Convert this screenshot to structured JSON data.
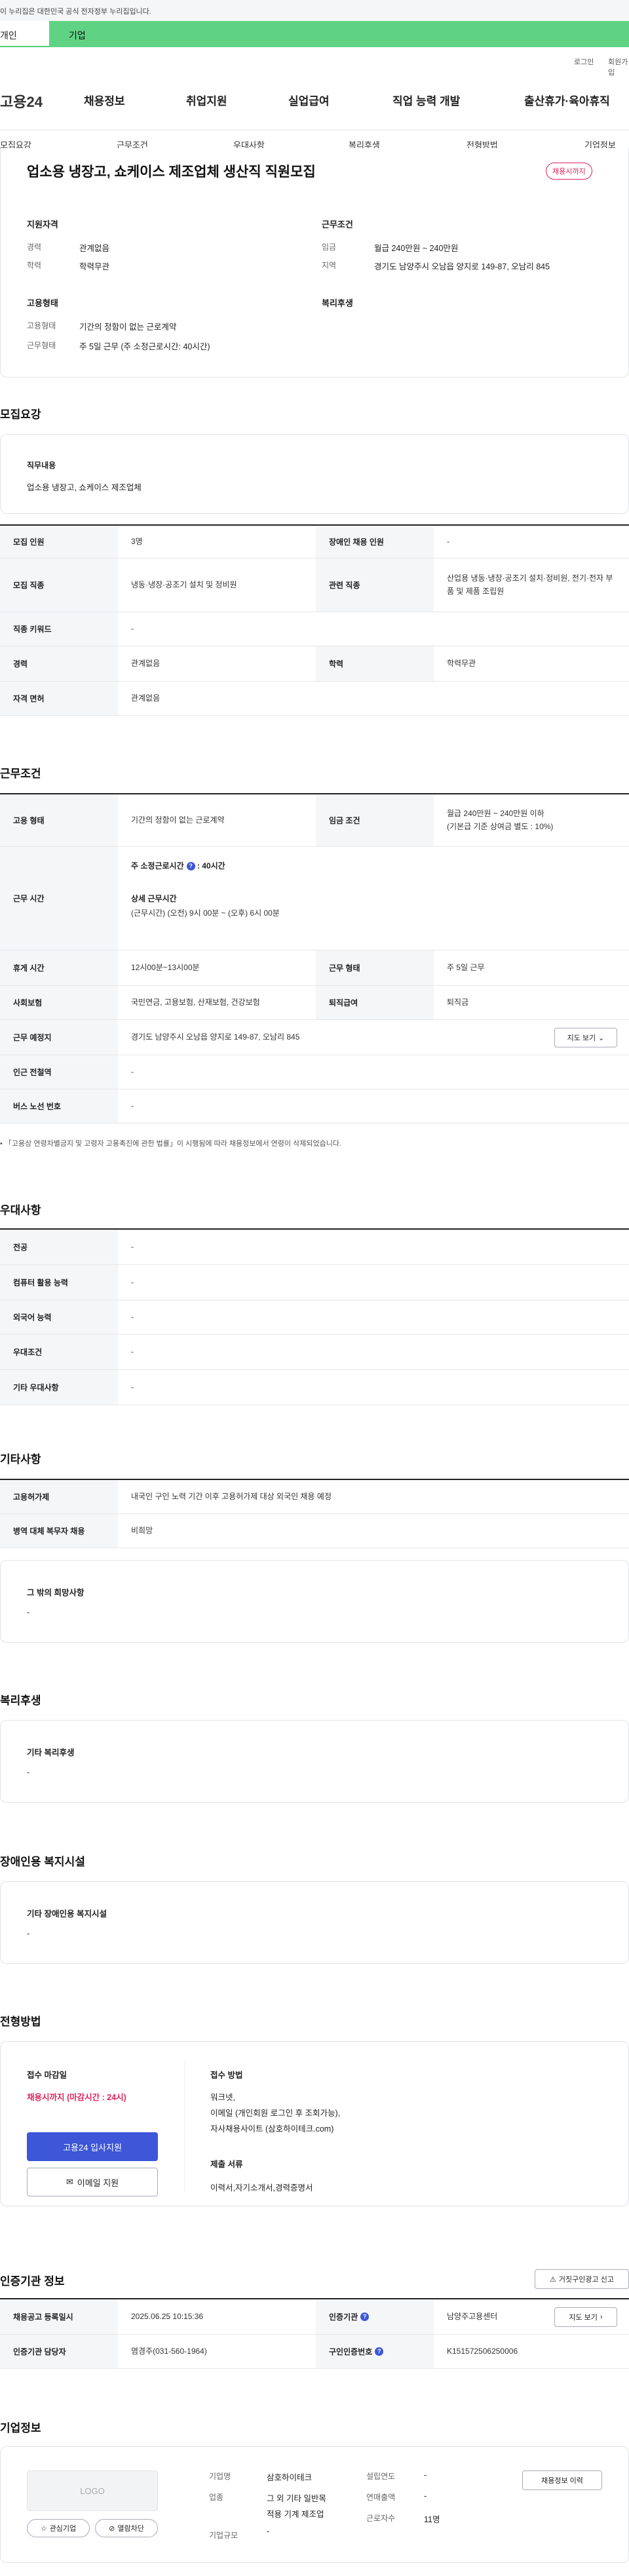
{
  "gov_banner": "이 누리집은 대한민국 공식 전자정부 누리집입니다.",
  "tabs": {
    "person": "개인",
    "company": "기업"
  },
  "util": {
    "login": "로그인",
    "join": "회원가입"
  },
  "logo": "고용24",
  "gnb": [
    "채용정보",
    "취업지원",
    "실업급여",
    "직업 능력 개발",
    "출산휴가·육아휴직"
  ],
  "subnav": [
    "모집요강",
    "근무조건",
    "우대사항",
    "복리후생",
    "전형방법",
    "기업정보"
  ],
  "summary": {
    "title": "업소용 냉장고, 쇼케이스 제조업체 생산직 직원모집",
    "badge": "채용시까지",
    "qual_h": "지원자격",
    "career_l": "경력",
    "career_v": "관계없음",
    "edu_l": "학력",
    "edu_v": "학력무관",
    "cond_h": "근무조건",
    "wage_l": "임금",
    "wage_v": "월급 240만원 ~ 240만원",
    "area_l": "지역",
    "area_v": "경기도 남양주시 오남읍 양지로 149-87, 오남리 845",
    "emp_h": "고용형태",
    "emp_l1": "고용형태",
    "emp_v1": "기간의 정함이 없는 근로계약",
    "emp_l2": "근무형태",
    "emp_v2": "주 5일 근무 (주 소정근로시간: 40시간)",
    "welfare_h": "복리후생"
  },
  "recruit": {
    "heading": "모집요강",
    "job_h": "직무내용",
    "job_v": "업소용 냉장고, 쇼케이스 제조업체",
    "rows": {
      "count_l": "모집 인원",
      "count_v": "3명",
      "dis_l": "장애인 채용 인원",
      "dis_v": "-",
      "type_l": "모집 직종",
      "type_v": "냉동·냉장·공조기 설치 및 정비원",
      "rel_l": "관련 직종",
      "rel_v": "산업용 냉동·냉장·공조기 설치·정비원, 전기·전자 부품 및 제품 조립원",
      "kw_l": "직종 키워드",
      "kw_v": "-",
      "career_l": "경력",
      "career_v": "관계없음",
      "edu_l": "학력",
      "edu_v": "학력무관",
      "lic_l": "자격 면허",
      "lic_v": "관계없음"
    }
  },
  "work": {
    "heading": "근무조건",
    "emp_l": "고용 형태",
    "emp_v": "기간의 정함이 없는 근로계약",
    "wage_l": "임금 조건",
    "wage_v1": "월급 240만원 ~ 240만원 이하",
    "wage_v2": "(기본급 기준 상여금 별도 : 10%)",
    "hours_l": "근무 시간",
    "hours_v1": "주 소정근로시간",
    "hours_v1b": ": 40시간",
    "hours_v2": "상세 근무시간",
    "hours_v3": "(근무시간) (오전) 9시 00분 ~ (오후) 6시 00분",
    "rest_l": "휴게 시간",
    "rest_v": "12시00분~13시00분",
    "form_l": "근무 형태",
    "form_v": "주 5일 근무",
    "ins_l": "사회보험",
    "ins_v": "국민연금, 고용보험, 산재보험, 건강보험",
    "sev_l": "퇴직급여",
    "sev_v": "퇴직금",
    "place_l": "근무 예정지",
    "place_v": "경기도 남양주시 오남읍 양지로 149-87, 오남리 845",
    "map_btn": "지도 보기",
    "sub_l": "인근 전철역",
    "sub_v": "-",
    "bus_l": "버스 노선 번호",
    "bus_v": "-",
    "note": "「고용상 연령차별금지 및 고령자 고용촉진에 관한 법률」이 시행됨에 따라 채용정보에서 연령이 삭제되었습니다."
  },
  "pref": {
    "heading": "우대사항",
    "rows": [
      [
        "전공",
        "-"
      ],
      [
        "컴퓨터 활용 능력",
        "-"
      ],
      [
        "외국어 능력",
        "-"
      ],
      [
        "우대조건",
        "-"
      ],
      [
        "기타 우대사항",
        "-"
      ]
    ]
  },
  "etc": {
    "heading": "기타사항",
    "rows": [
      [
        "고용허가제",
        "내국인 구인 노력 기간 이후 고용허가제 대상 외국인 채용 예정"
      ],
      [
        "병역 대체 복무자 채용",
        "비희망"
      ]
    ],
    "other_h": "그 밖의 희망사항",
    "other_v": "-"
  },
  "welfare": {
    "heading": "복리후생",
    "h": "기타 복리후생",
    "v": "-"
  },
  "disab": {
    "heading": "장애인용 복지시설",
    "h": "기타 장애인용 복지시설",
    "v": "-"
  },
  "select": {
    "heading": "전형방법",
    "deadline_h": "접수 마감일",
    "deadline_v": "채용시까지 (마감시간 : 24시)",
    "apply_btn": "고용24 입사지원",
    "email_btn": "이메일 지원",
    "method_h": "접수 방법",
    "method_v1": "워크넷,",
    "method_v2": "이메일 (개인회원 로그인 후 조회가능),",
    "method_v3": "자사채용사이트 (삼호하이테크.com)",
    "docs_h": "제출 서류",
    "docs_v": "이력서,자기소개서,경력증명서"
  },
  "cert": {
    "heading": "인증기관 정보",
    "report_btn": "거짓구인광고 신고",
    "date_l": "채용공고 등록일시",
    "date_v": "2025.06.25 10:15:36",
    "org_l": "인증기관",
    "org_v": "남양주고용센터",
    "map_btn": "지도 보기",
    "mgr_l": "인증기관 담당자",
    "mgr_v": "염경주(031-560-1964)",
    "num_l": "구인인증번호",
    "num_v": "K151572506250006"
  },
  "company": {
    "heading": "기업정보",
    "logo": "LOGO",
    "fav_btn": "관심기업",
    "block_btn": "열람차단",
    "name_l": "기업명",
    "name_v": "삼호하이테크",
    "ind_l": "업종",
    "ind_v1": "그 외 기타 일반목",
    "ind_v2": "적용 기계 제조업",
    "size_l": "기업규모",
    "size_v": "-",
    "year_l": "설립연도",
    "year_v": "-",
    "sales_l": "연매출액",
    "sales_v": "-",
    "emp_l": "근로자수",
    "emp_v": "11명",
    "hist_btn": "채용정보 이력"
  }
}
